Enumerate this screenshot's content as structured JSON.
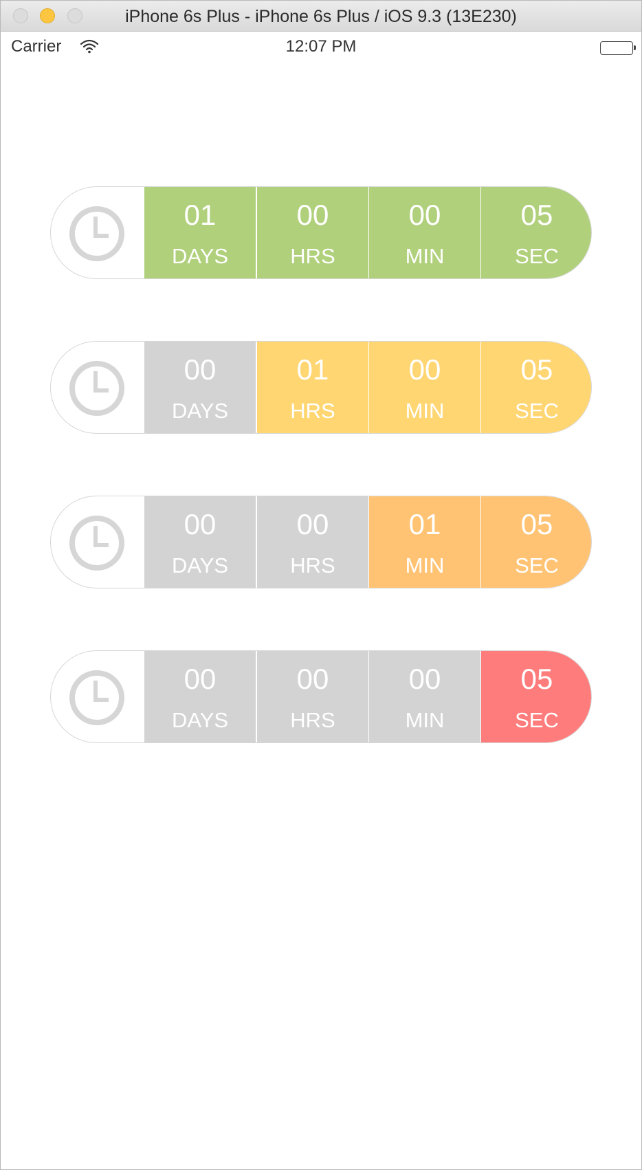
{
  "window": {
    "title": "iPhone 6s Plus - iPhone 6s Plus / iOS 9.3 (13E230)"
  },
  "status_bar": {
    "carrier": "Carrier",
    "time": "12:07 PM",
    "wifi_icon": "wifi-icon",
    "battery_icon": "battery-icon"
  },
  "colors": {
    "inactive": "#d3d3d3",
    "green": "#b0d07c",
    "yellow": "#ffd672",
    "orange": "#ffc373",
    "red": "#ff7c7c",
    "clock_icon": "#d6d6d6"
  },
  "timers": [
    {
      "icon": "clock-icon",
      "segments": [
        {
          "value": "01",
          "unit": "DAYS",
          "color": "#b0d07c"
        },
        {
          "value": "00",
          "unit": "HRS",
          "color": "#b0d07c"
        },
        {
          "value": "00",
          "unit": "MIN",
          "color": "#b0d07c"
        },
        {
          "value": "05",
          "unit": "SEC",
          "color": "#b0d07c"
        }
      ]
    },
    {
      "icon": "clock-icon",
      "segments": [
        {
          "value": "00",
          "unit": "DAYS",
          "color": "#d3d3d3"
        },
        {
          "value": "01",
          "unit": "HRS",
          "color": "#ffd672"
        },
        {
          "value": "00",
          "unit": "MIN",
          "color": "#ffd672"
        },
        {
          "value": "05",
          "unit": "SEC",
          "color": "#ffd672"
        }
      ]
    },
    {
      "icon": "clock-icon",
      "segments": [
        {
          "value": "00",
          "unit": "DAYS",
          "color": "#d3d3d3"
        },
        {
          "value": "00",
          "unit": "HRS",
          "color": "#d3d3d3"
        },
        {
          "value": "01",
          "unit": "MIN",
          "color": "#ffc373"
        },
        {
          "value": "05",
          "unit": "SEC",
          "color": "#ffc373"
        }
      ]
    },
    {
      "icon": "clock-icon",
      "segments": [
        {
          "value": "00",
          "unit": "DAYS",
          "color": "#d3d3d3"
        },
        {
          "value": "00",
          "unit": "HRS",
          "color": "#d3d3d3"
        },
        {
          "value": "00",
          "unit": "MIN",
          "color": "#d3d3d3"
        },
        {
          "value": "05",
          "unit": "SEC",
          "color": "#ff7c7c"
        }
      ]
    }
  ]
}
